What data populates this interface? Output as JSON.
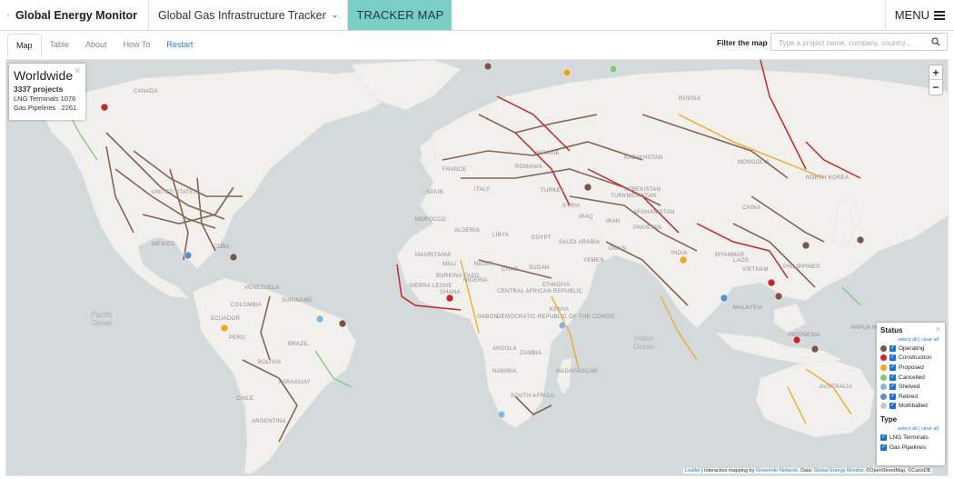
{
  "brand": {
    "name": "Global Energy Monitor"
  },
  "header": {
    "tracker_select": "Global Gas Infrastructure Tracker",
    "tracker_tab": "TRACKER MAP",
    "menu_label": "MENU"
  },
  "tabs": [
    {
      "label": "Map",
      "active": true
    },
    {
      "label": "Table"
    },
    {
      "label": "About"
    },
    {
      "label": "How To"
    },
    {
      "label": "Restart"
    }
  ],
  "filter": {
    "label": "Filter the map",
    "placeholder": "Type a project name, company, country..."
  },
  "summary": {
    "title": "Worldwide",
    "projects": "3337 projects",
    "lng_label": "LNG Terminals",
    "lng_count": "1076",
    "pipe_label": "Gas Pipelines",
    "pipe_count": "2261"
  },
  "zoom": {
    "in": "+",
    "out": "−"
  },
  "legend": {
    "status_title": "Status",
    "select_all": "select all",
    "separator": "|",
    "clear_all": "clear all",
    "status": [
      {
        "label": "Operating",
        "color": "#7b5545"
      },
      {
        "label": "Construction",
        "color": "#c2272d"
      },
      {
        "label": "Proposed",
        "color": "#f4a321"
      },
      {
        "label": "Cancelled",
        "color": "#7fc97f"
      },
      {
        "label": "Shelved",
        "color": "#8ab6d6"
      },
      {
        "label": "Retired",
        "color": "#5c8ed0"
      },
      {
        "label": "Mothballed",
        "color": "#c9c9c9"
      }
    ],
    "type_title": "Type",
    "types": [
      {
        "label": "LNG Terminals"
      },
      {
        "label": "Gas Pipelines"
      }
    ]
  },
  "attribution": {
    "leaflet": "Leaflet",
    "text1": " | Interactive mapping by ",
    "greeninfo": "GreenInfo Network",
    "text2": ". Data: ",
    "gem": "Global Energy Monitor",
    "text3": ", ©OpenStreetMap, ©CartoDB"
  },
  "map_labels": {
    "canada": "CANADA",
    "united_states": "UNITED STATES",
    "mexico": "MEXICO",
    "cuba": "CUBA",
    "venezuela": "VENEZUELA",
    "colombia": "COLOMBIA",
    "ecuador": "ECUADOR",
    "peru": "PERU",
    "brazil": "BRAZIL",
    "bolivia": "BOLIVIA",
    "paraguay": "PARAGUAY",
    "chile": "CHILE",
    "argentina": "ARGENTINA",
    "suriname": "SURINAME",
    "morocco": "MOROCCO",
    "algeria": "ALGERIA",
    "libya": "LIBYA",
    "egypt": "EGYPT",
    "mauritania": "MAURITANIA",
    "mali": "MALI",
    "niger": "NIGER",
    "chad": "CHAD",
    "sudan": "SUDAN",
    "nigeria": "NIGERIA",
    "burkina_faso": "BURKINA FASO",
    "sierra_leone": "SIERRA LEONE",
    "ghana": "GHANA",
    "ethiopia": "ETHIOPIA",
    "car": "CENTRAL AFRICAN REPUBLIC",
    "gabon": "GABON",
    "drc": "DEMOCRATIC REPUBLIC OF THE CONGO",
    "kenya": "KENYA",
    "angola": "ANGOLA",
    "zambia": "ZAMBIA",
    "namibia": "NAMIBIA",
    "south_africa": "SOUTH AFRICA",
    "madagascar": "MADAGASCAR",
    "spain": "SPAIN",
    "france": "FRANCE",
    "italy": "ITALY",
    "romania": "ROMANIA",
    "ukraine": "UKRAINE",
    "turkey": "TURKEY",
    "syria": "SYRIA",
    "iraq": "IRAQ",
    "iran": "IRAN",
    "saudi_arabia": "SAUDI ARABIA",
    "oman": "OMAN",
    "yemen": "YEMEN",
    "kazakhstan": "KAZAKHSTAN",
    "uzbekistan": "UZBEKISTAN",
    "turkmenistan": "TURKMENISTAN",
    "afghanistan": "AFGHANISTAN",
    "pakistan": "PAKISTAN",
    "india": "INDIA",
    "mongolia": "MONGOLIA",
    "china": "CHINA",
    "north_korea": "NORTH KOREA",
    "myanmar": "MYANMAR",
    "laos": "LAOS",
    "vietnam": "VIETNAM",
    "philippines": "PHILIPPINES",
    "malaysia": "MALAYSIA",
    "indonesia": "INDONESIA",
    "papua": "PAPUA NEW GUINEA",
    "australia": "AUSTRALIA",
    "russia": "RUSSIA",
    "pacific": "Pacific\nOcean",
    "indian": "Indian\nOcean"
  }
}
